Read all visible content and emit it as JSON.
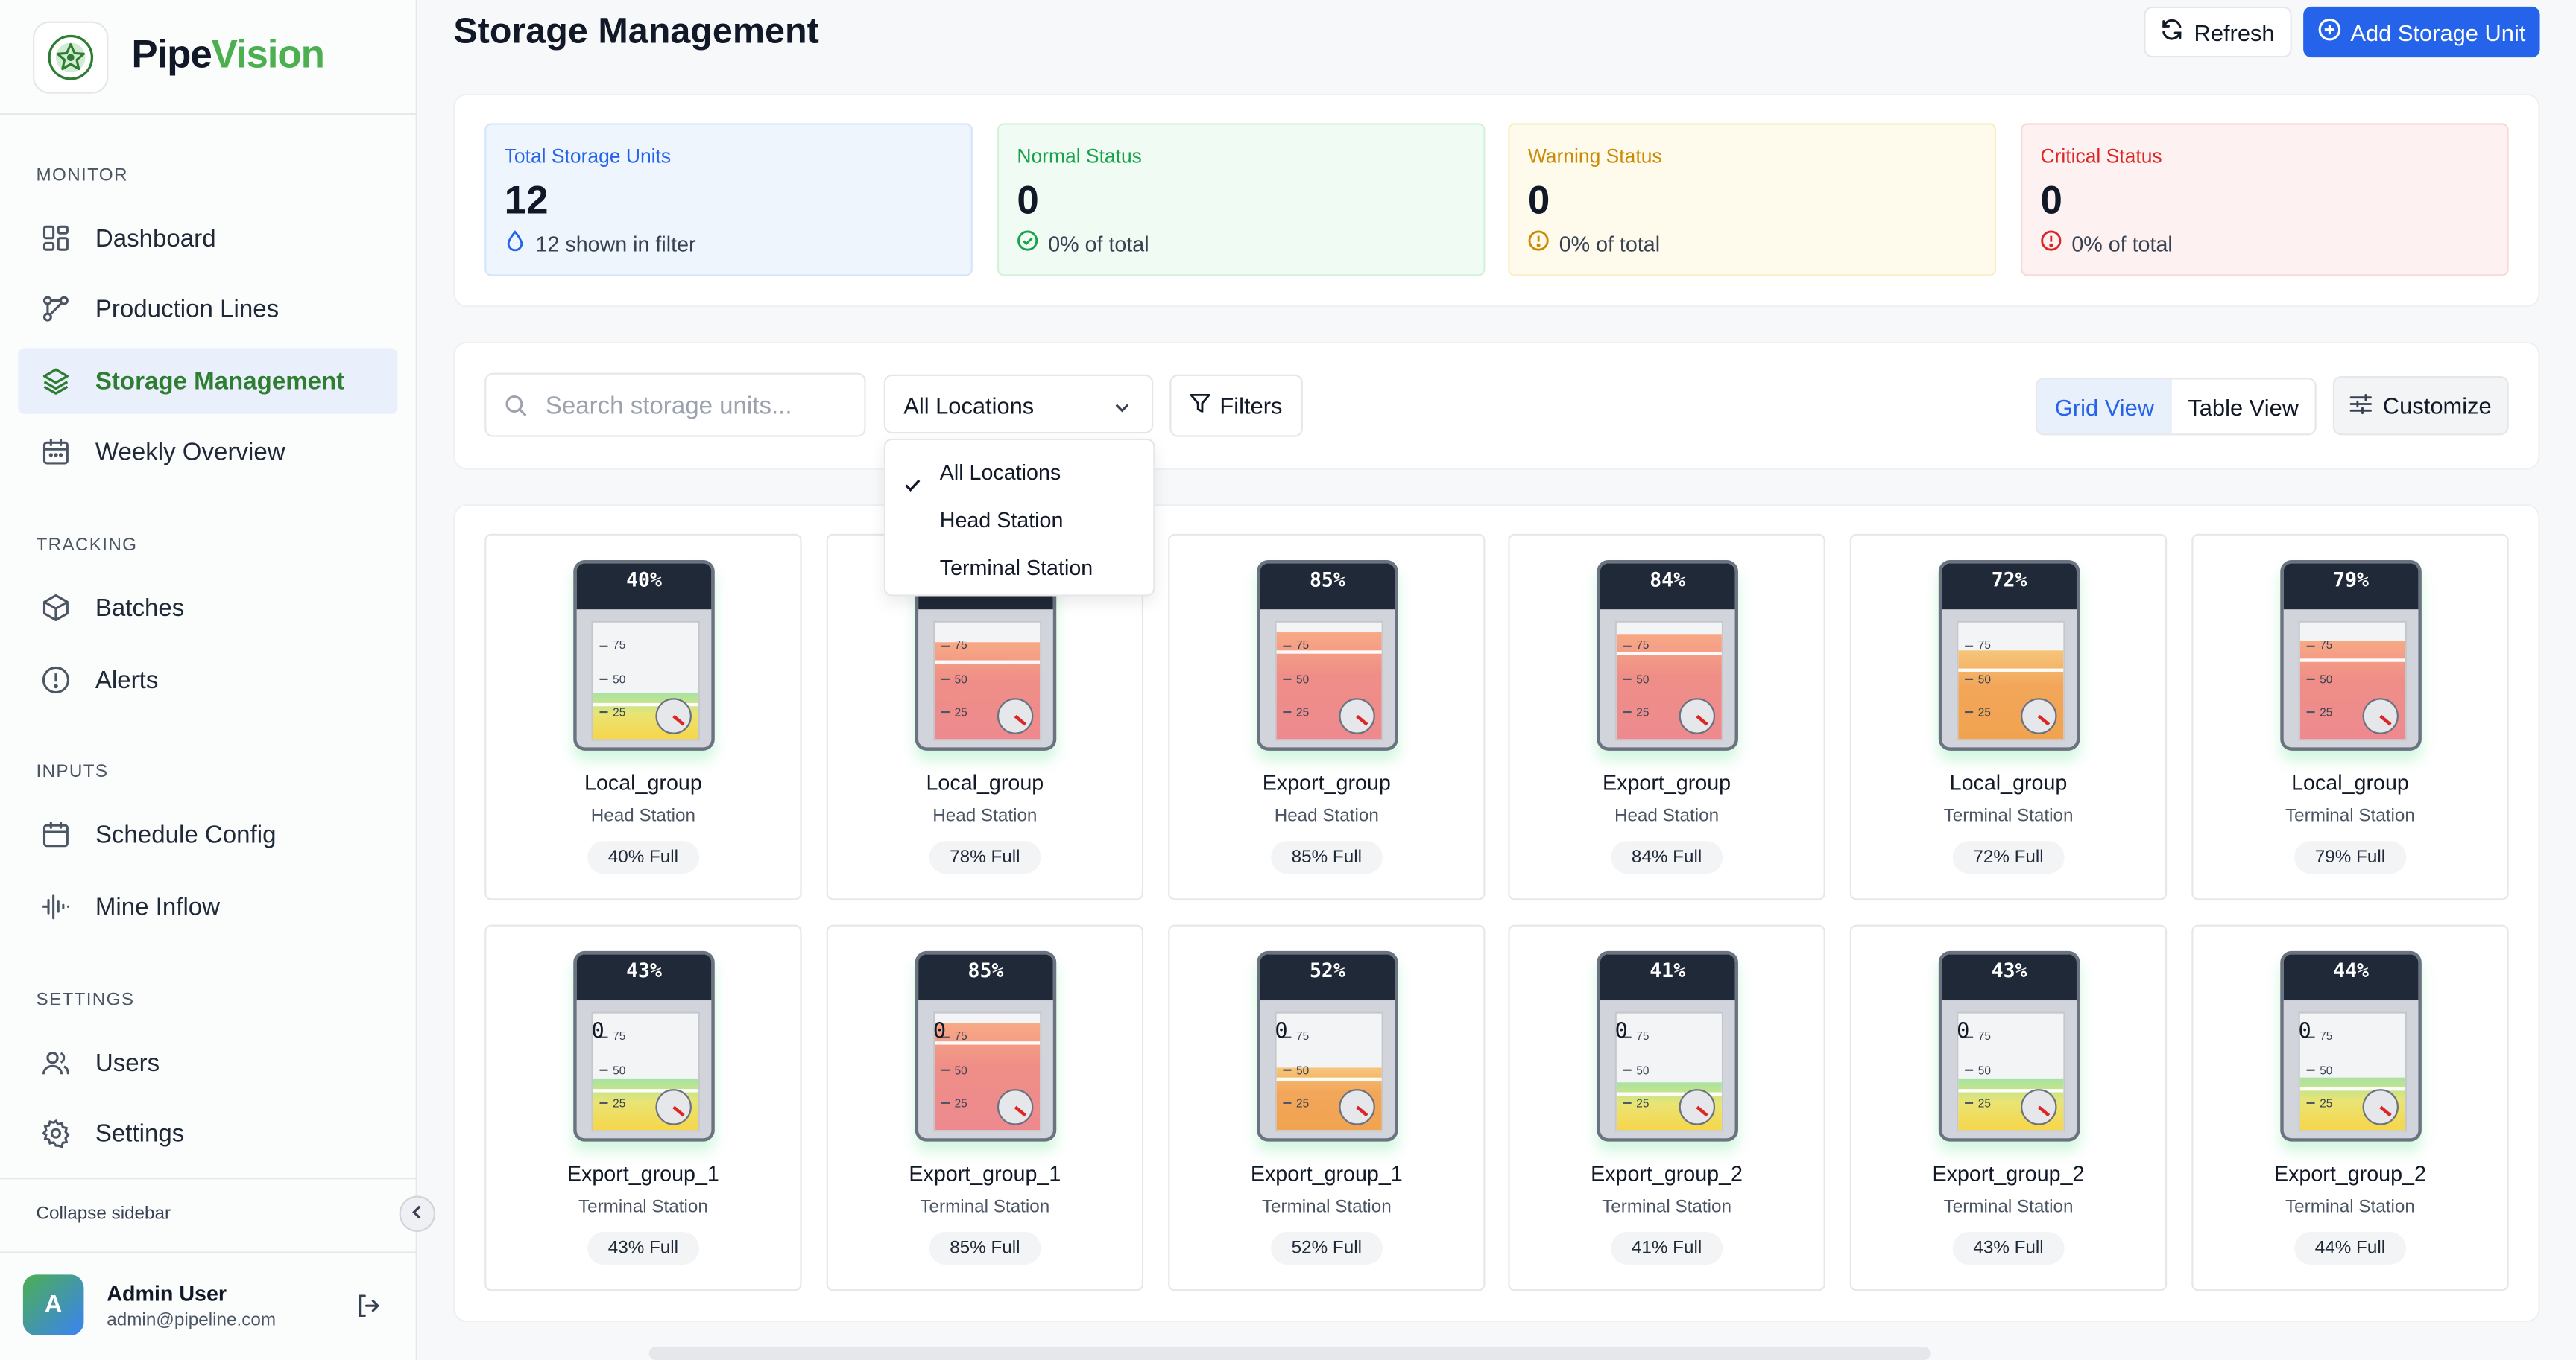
{
  "brand": {
    "name_part1": "Pipe",
    "name_part2": "Vision"
  },
  "sidebar": {
    "sections": [
      {
        "label": "MONITOR",
        "items": [
          {
            "label": "Dashboard",
            "icon": "grid-icon"
          },
          {
            "label": "Production Lines",
            "icon": "workflow-icon"
          },
          {
            "label": "Storage Management",
            "icon": "layers-icon",
            "active": true
          },
          {
            "label": "Weekly Overview",
            "icon": "calendar-icon"
          }
        ]
      },
      {
        "label": "TRACKING",
        "items": [
          {
            "label": "Batches",
            "icon": "box-icon"
          },
          {
            "label": "Alerts",
            "icon": "alert-circle-icon"
          }
        ]
      },
      {
        "label": "INPUTS",
        "items": [
          {
            "label": "Schedule Config",
            "icon": "calendar-icon"
          },
          {
            "label": "Mine Inflow",
            "icon": "waveform-icon"
          }
        ]
      },
      {
        "label": "SETTINGS",
        "items": [
          {
            "label": "Users",
            "icon": "users-icon"
          },
          {
            "label": "Settings",
            "icon": "gear-icon"
          }
        ]
      }
    ],
    "collapse_label": "Collapse sidebar",
    "user": {
      "initial": "A",
      "name": "Admin User",
      "email": "admin@pipeline.com"
    }
  },
  "header": {
    "title": "Storage Management",
    "refresh_label": "Refresh",
    "add_label": "Add Storage Unit"
  },
  "stats": [
    {
      "title": "Total Storage Units",
      "value": "12",
      "sub": "12 shown in filter",
      "color": "#2563eb",
      "bg": "#eef5fd",
      "border": "#d6e6fa",
      "icon": "droplet-icon"
    },
    {
      "title": "Normal Status",
      "value": "0",
      "sub": "0% of total",
      "color": "#16a34a",
      "bg": "#f0fbf3",
      "border": "#d4f1dc",
      "icon": "check-circle-icon"
    },
    {
      "title": "Warning Status",
      "value": "0",
      "sub": "0% of total",
      "color": "#ca8a04",
      "bg": "#fefbec",
      "border": "#f8eec3",
      "icon": "alert-circle-icon"
    },
    {
      "title": "Critical Status",
      "value": "0",
      "sub": "0% of total",
      "color": "#dc2626",
      "bg": "#fdf1f1",
      "border": "#f8d8d8",
      "icon": "alert-circle-icon"
    }
  ],
  "toolbar": {
    "search_placeholder": "Search storage units...",
    "location_value": "All Locations",
    "filters_label": "Filters",
    "grid_view_label": "Grid View",
    "table_view_label": "Table View",
    "customize_label": "Customize"
  },
  "location_dropdown": {
    "options": [
      "All Locations",
      "Head Station",
      "Terminal Station"
    ],
    "selected": "All Locations"
  },
  "units": [
    {
      "name": "Local_group",
      "location": "Head Station",
      "level": 40,
      "fill": "green"
    },
    {
      "name": "Local_group",
      "location": "Head Station",
      "level": 78,
      "fill": "red"
    },
    {
      "name": "Export_group",
      "location": "Head Station",
      "level": 85,
      "fill": "red"
    },
    {
      "name": "Export_group",
      "location": "Head Station",
      "level": 84,
      "fill": "red"
    },
    {
      "name": "Local_group",
      "location": "Terminal Station",
      "level": 72,
      "fill": "orange"
    },
    {
      "name": "Local_group",
      "location": "Terminal Station",
      "level": 79,
      "fill": "red"
    },
    {
      "name": "Export_group_1",
      "location": "Terminal Station",
      "level": 43,
      "fill": "green"
    },
    {
      "name": "Export_group_1",
      "location": "Terminal Station",
      "level": 85,
      "fill": "red"
    },
    {
      "name": "Export_group_1",
      "location": "Terminal Station",
      "level": 52,
      "fill": "orange"
    },
    {
      "name": "Export_group_2",
      "location": "Terminal Station",
      "level": 41,
      "fill": "green"
    },
    {
      "name": "Export_group_2",
      "location": "Terminal Station",
      "level": 43,
      "fill": "green"
    },
    {
      "name": "Export_group_2",
      "location": "Terminal Station",
      "level": 44,
      "fill": "green"
    }
  ],
  "tank_scale": [
    "75",
    "50",
    "25"
  ],
  "tank_zero_label": "0",
  "full_suffix": "% Full",
  "percent_suffix": "%"
}
